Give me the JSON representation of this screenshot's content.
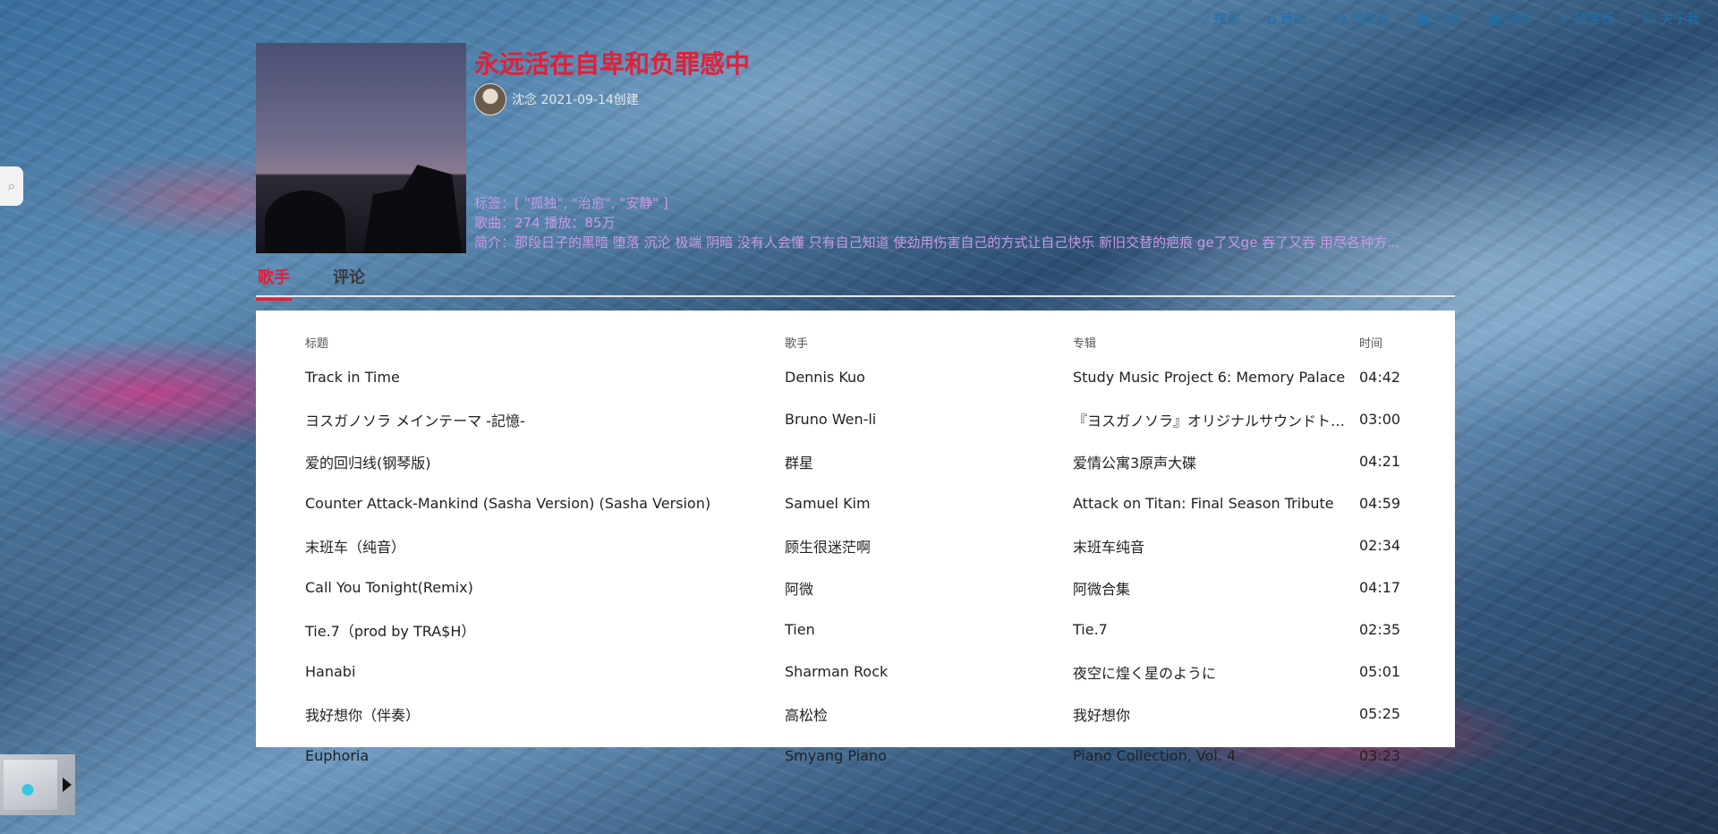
{
  "nav": [
    {
      "icon": "search-icon",
      "glyph": "⌕",
      "label": "搜索"
    },
    {
      "icon": "home-icon",
      "glyph": "⌂",
      "label": "首页"
    },
    {
      "icon": "headphones-icon",
      "glyph": "☊",
      "label": "音乐盒"
    },
    {
      "icon": "category-icon",
      "glyph": "▤",
      "label": "分类"
    },
    {
      "icon": "grid-icon",
      "glyph": "▦",
      "label": "归档"
    },
    {
      "icon": "send-icon",
      "glyph": "➢",
      "label": "留言板"
    },
    {
      "icon": "user-icon",
      "glyph": "☺",
      "label": "关于我"
    }
  ],
  "playlist": {
    "title": "永远活在自卑和负罪感中",
    "creator": "沈念 2021-09-14创建",
    "tags": "标签：[ \"孤独\", \"治愈\", \"安静\" ]",
    "stats": "歌曲：274  播放：85万",
    "description": "简介：那段日子的黑暗 堕落 沉沦 极端 阴暗 没有人会懂 只有自己知道 使劲用伤害自己的方式让自己快乐 新旧交替的疤痕 ge了又ge 吞了又吞 用尽各种方..."
  },
  "tabs": [
    "歌手",
    "评论"
  ],
  "table": {
    "headers": [
      "标题",
      "歌手",
      "专辑",
      "时间"
    ],
    "rows": [
      [
        "Track in Time",
        "Dennis Kuo",
        "Study Music Project 6: Memory Palace",
        "04:42"
      ],
      [
        "ヨスガノソラ メインテーマ -記憶-",
        "Bruno Wen-li",
        "『ヨスガノソラ』オリジナルサウンドトラック",
        "03:00"
      ],
      [
        "爱的回归线(钢琴版)",
        "群星",
        "爱情公寓3原声大碟",
        "04:21"
      ],
      [
        "Counter Attack-Mankind (Sasha Version) (Sasha Version)",
        "Samuel Kim",
        "Attack on Titan: Final Season Tribute",
        "04:59"
      ],
      [
        "末班车（纯音）",
        "顾生很迷茫啊",
        "末班车纯音",
        "02:34"
      ],
      [
        "Call You Tonight(Remix)",
        "阿微",
        "阿微合集",
        "04:17"
      ],
      [
        "Tie.7（prod by TRA$H）",
        "Tien",
        "Tie.7",
        "02:35"
      ],
      [
        "Hanabi",
        "Sharman Rock",
        "夜空に煌く星のように",
        "05:01"
      ],
      [
        "我好想你（伴奏）",
        "高松检",
        "我好想你",
        "05:25"
      ],
      [
        "Euphoria",
        "Smyang Piano",
        "Piano Collection, Vol. 4",
        "03:23"
      ]
    ]
  }
}
